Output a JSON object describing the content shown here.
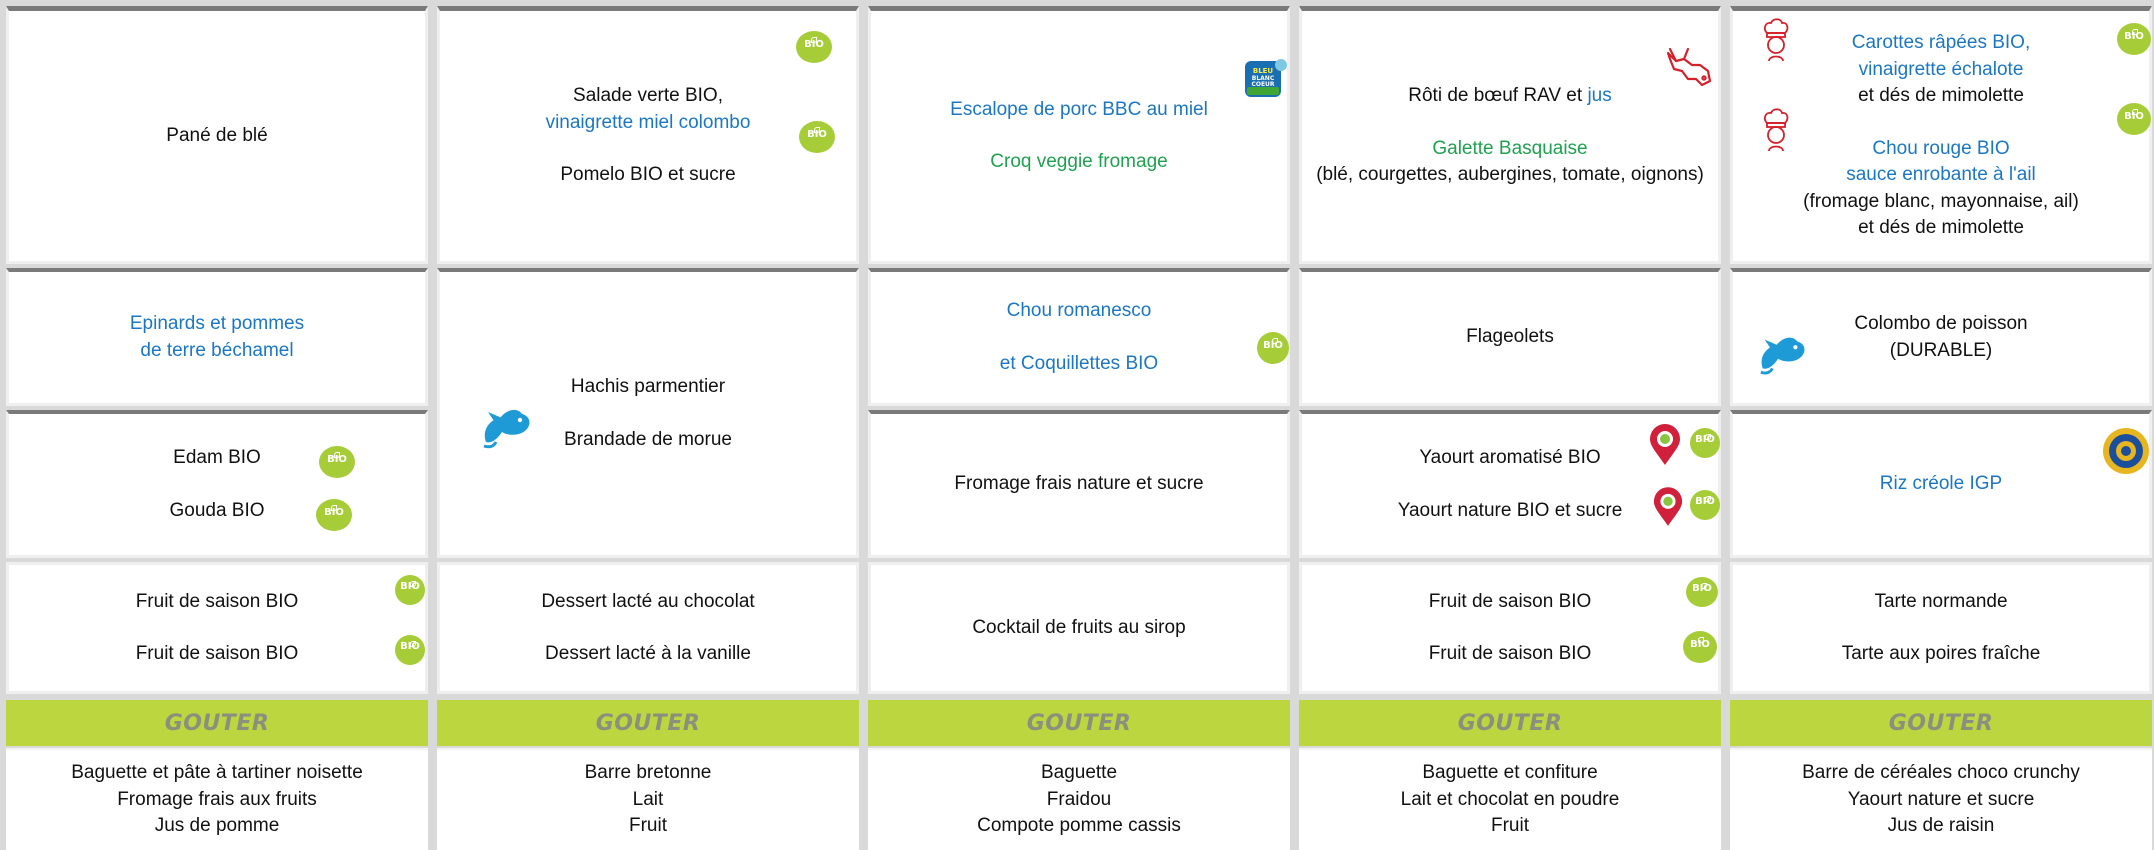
{
  "days": [
    {
      "starter": [
        "Pané de blé"
      ],
      "main": [
        "Epinards et pommes",
        "de terre béchamel"
      ],
      "cheese": [
        "Edam BIO",
        "Gouda BIO"
      ],
      "dessert": [
        "Fruit de saison BIO",
        "Fruit de saison BIO"
      ],
      "goute_label": "GOUTER",
      "goute": [
        "Baguette et pâte à tartiner noisette",
        "Fromage frais aux fruits",
        "Jus de pomme"
      ]
    },
    {
      "starter_a": "Salade verte BIO,",
      "starter_b": "vinaigrette miel colombo",
      "starter_c": "Pomelo BIO et sucre",
      "main": [
        "Hachis parmentier",
        "Brandade de morue"
      ],
      "dessert": [
        "Dessert lacté au chocolat",
        "Dessert lacté à la vanille"
      ],
      "goute_label": "GOUTER",
      "goute": [
        "Barre bretonne",
        "Lait",
        "Fruit"
      ]
    },
    {
      "starter": [
        "Escalope de porc BBC au miel",
        "Croq veggie fromage"
      ],
      "logo_text": "BLEU BLANC COEUR",
      "main": [
        "Chou romanesco",
        "et Coquillettes BIO"
      ],
      "cheese": [
        "Fromage frais nature et sucre"
      ],
      "dessert": [
        "Cocktail de fruits au sirop"
      ],
      "goute_label": "GOUTER",
      "goute": [
        "Baguette",
        "Fraidou",
        "Compote pomme cassis"
      ]
    },
    {
      "starter_a": "Rôti de bœuf RAV et ",
      "starter_a_jus": "jus",
      "starter_b": "Galette Basquaise",
      "starter_c": "(blé, courgettes, aubergines, tomate, oignons)",
      "main": [
        "Flageolets"
      ],
      "cheese": [
        "Yaourt aromatisé BIO",
        "Yaourt nature BIO et sucre"
      ],
      "dessert": [
        "Fruit de saison BIO",
        "Fruit de saison BIO"
      ],
      "goute_label": "GOUTER",
      "goute": [
        "Baguette et confiture",
        "Lait et chocolat en poudre",
        "Fruit"
      ]
    },
    {
      "starter_a": [
        "Carottes râpées BIO,",
        "vinaigrette échalote"
      ],
      "starter_b": "et dés de mimolette",
      "starter_c": [
        "Chou rouge BIO",
        "sauce enrobante à l'ail"
      ],
      "starter_d": [
        "(fromage blanc, mayonnaise, ail)",
        "et dés de mimolette"
      ],
      "main": [
        "Colombo de poisson",
        "(DURABLE)"
      ],
      "cheese": [
        "Riz créole IGP"
      ],
      "dessert": [
        "Tarte normande",
        "Tarte aux poires fraîche"
      ],
      "goute_label": "GOUTER",
      "goute": [
        "Barre de céréales choco crunchy",
        "Yaourt nature et sucre",
        "Jus de raisin"
      ]
    }
  ],
  "badges": {
    "bio_label": "BIO"
  },
  "colors": {
    "bio_green": "#a6cd38",
    "goute_band": "#bcd63f",
    "blue_text": "#1c77c3",
    "green_text": "#1fa14f"
  }
}
